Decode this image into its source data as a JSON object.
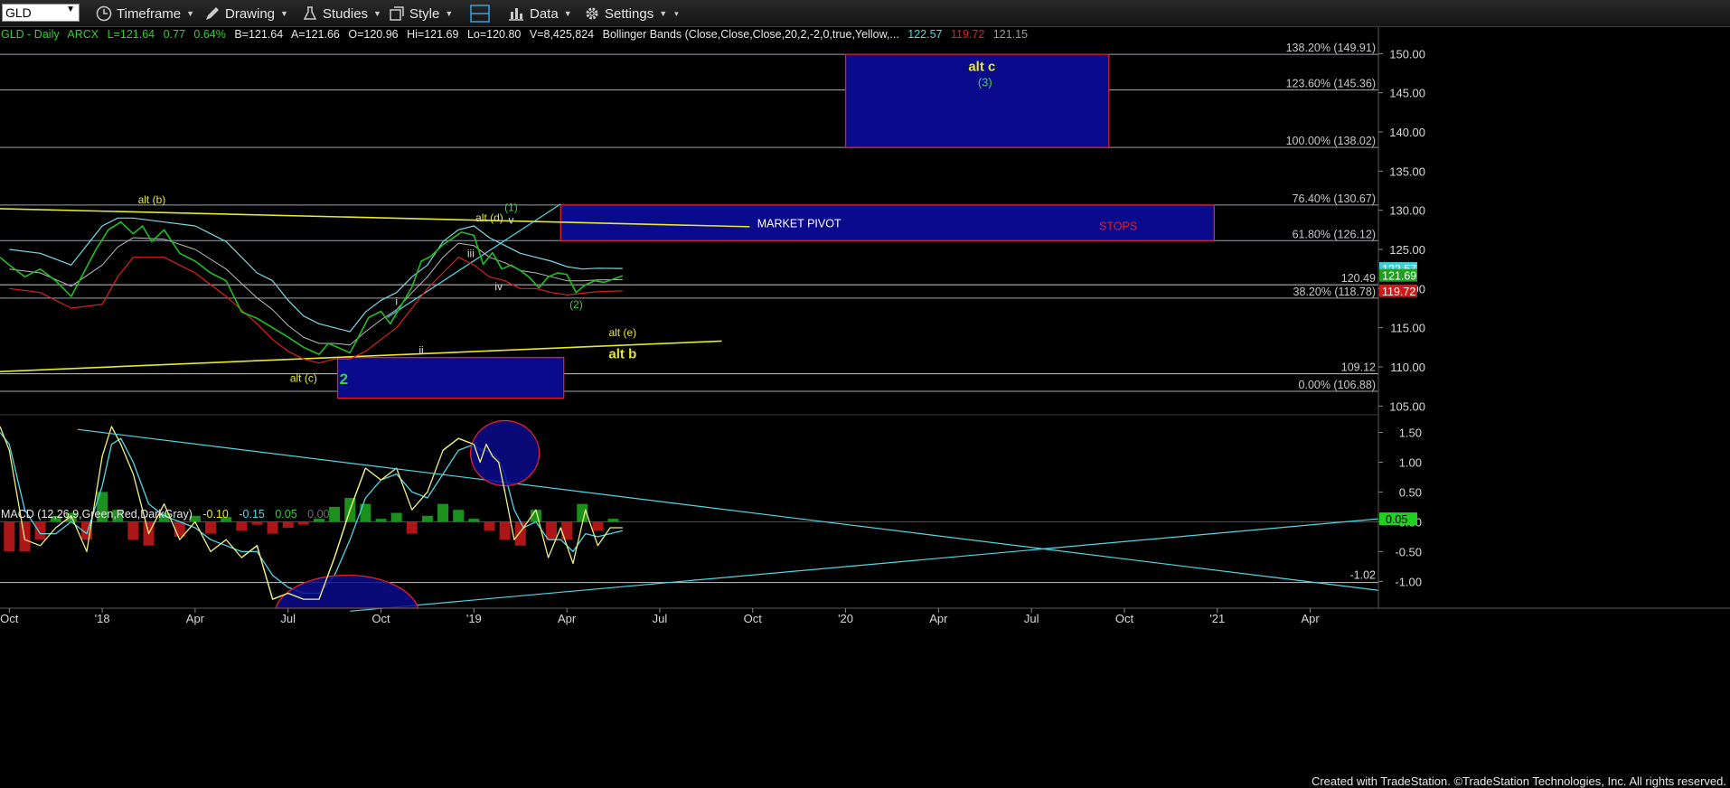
{
  "toolbar": {
    "symbol": "GLD",
    "timeframe": "Timeframe",
    "drawing": "Drawing",
    "studies": "Studies",
    "style": "Style",
    "data": "Data",
    "settings": "Settings"
  },
  "header": {
    "name": "GLD - Daily",
    "exchange": "ARCX",
    "last": "L=121.64",
    "change": "0.77",
    "change_pct": "0.64%",
    "bid": "B=121.64",
    "ask": "A=121.66",
    "open": "O=120.96",
    "high": "Hi=121.69",
    "low": "Lo=120.80",
    "volume": "V=8,425,824",
    "bb_label": "Bollinger Bands (Close,Close,Close,20,2,-2,0,true,Yellow,...",
    "bb_upper": "122.57",
    "bb_lower": "119.72",
    "bb_mid": "121.15"
  },
  "macd_header": {
    "label": "MACD (12,26,9,Green,Red,DarkGray)",
    "macd": "-0.10",
    "signal": "-0.15",
    "diff": "0.05",
    "zero": "0.00"
  },
  "colors": {
    "price": "#20c020",
    "upper_band": "#7fd8e8",
    "lower_band": "#e02020",
    "mid_band": "#bbbbbb",
    "trendline": "#e8e830",
    "box_fill": "#0a0a8c",
    "box_border": "#e0202a",
    "fib_line": "#9aa3ad",
    "wave_label": "#e8e830",
    "wave_label_green": "#40d040",
    "macd_line": "#f0f080",
    "signal_line": "#4fd8e8",
    "hist_pos": "#1fa01f",
    "hist_neg": "#c01818"
  },
  "fib_labels": [
    {
      "text": "138.20% (149.91)",
      "value": 149.91
    },
    {
      "text": "123.60% (145.36)",
      "value": 145.36
    },
    {
      "text": "100.00% (138.02)",
      "value": 138.02
    },
    {
      "text": "76.40% (130.67)",
      "value": 130.67
    },
    {
      "text": "61.80% (126.12)",
      "value": 126.12
    },
    {
      "text": "38.20% (118.78)",
      "value": 118.78
    },
    {
      "text": "0.00% (106.88)",
      "value": 106.88
    }
  ],
  "level_labels": [
    {
      "text": "120.49",
      "value": 120.49
    },
    {
      "text": "109.12",
      "value": 109.12
    }
  ],
  "price_tags": [
    {
      "text": "122.57",
      "value": 122.57,
      "color": "#3fd0d8"
    },
    {
      "text": "121.69",
      "value": 121.69,
      "color": "#1fa01f"
    },
    {
      "text": "119.72",
      "value": 119.72,
      "color": "#d01818"
    }
  ],
  "annotations": {
    "alt_c": "alt c",
    "wave_3": "(3)",
    "market_pivot": "MARKET PIVOT",
    "stops": "STOPS",
    "alt_b_paren": "alt (b)",
    "alt_d_paren": "alt (d)",
    "wave_1": "(1)",
    "v": "v",
    "iii": "iii",
    "iv": "iv",
    "i": "i",
    "ii": "ii",
    "wave_2_paren": "(2)",
    "alt_e_paren": "alt (e)",
    "alt_b": "alt b",
    "alt_c_paren": "alt (c)",
    "wave_2": "2"
  },
  "macd_tags": [
    {
      "text": "0.05",
      "value": 0.05
    },
    {
      "text": "-1.02",
      "value": -1.02
    }
  ],
  "chart_data": {
    "type": "line",
    "title": "GLD - Daily",
    "price_axis": {
      "ylim": [
        104,
        152
      ],
      "ticks": [
        105.0,
        110.0,
        115.0,
        120.0,
        125.0,
        130.0,
        135.0,
        140.0,
        145.0,
        150.0
      ]
    },
    "macd_axis": {
      "ylim": [
        -1.45,
        1.75
      ],
      "ticks": [
        1.5,
        1.0,
        0.5,
        0.0,
        -0.5,
        -1.0
      ]
    },
    "x_tick_labels": [
      "Oct",
      "'18",
      "Apr",
      "Jul",
      "Oct",
      "'19",
      "Apr",
      "Jul",
      "Oct",
      "'20",
      "Apr",
      "Jul",
      "Oct",
      "'21",
      "Apr"
    ],
    "x_tick_months": [
      0,
      3,
      6,
      9,
      12,
      15,
      18,
      21,
      24,
      27,
      30,
      33,
      36,
      39,
      42
    ],
    "x_range_months": [
      -0.3,
      44.2
    ],
    "x_month_zero": "Oct 2017",
    "price_series": {
      "name": "GLD",
      "x": [
        -0.3,
        0,
        0.5,
        1,
        1.5,
        2,
        2.4,
        2.8,
        3.2,
        3.6,
        4,
        4.3,
        4.6,
        5,
        5.5,
        6,
        6.5,
        7,
        7.5,
        8,
        8.5,
        9,
        9.5,
        10,
        10.3,
        10.6,
        11,
        11.3,
        11.6,
        12,
        12.3,
        12.6,
        13,
        13.3,
        13.6,
        14,
        14.3,
        14.6,
        15,
        15.3,
        15.6,
        15.9,
        16.2,
        16.5,
        16.8,
        17.1,
        17.4,
        17.7,
        18,
        18.3,
        18.6,
        18.9,
        19.2,
        19.5,
        19.8
      ],
      "y": [
        124,
        123,
        121.5,
        122.5,
        121,
        119,
        122,
        125,
        127.5,
        128.5,
        127,
        128,
        126,
        127.5,
        124.5,
        123.5,
        122,
        121,
        117,
        116.2,
        115,
        113.8,
        112.5,
        111.6,
        113,
        112.5,
        111.8,
        114,
        116.3,
        117.1,
        115.5,
        117.5,
        120.2,
        123.5,
        124.1,
        125.6,
        126.4,
        127.2,
        126.8,
        123.1,
        124.6,
        122.5,
        123,
        122.3,
        121.4,
        120.1,
        121.5,
        122,
        121.8,
        119.5,
        120.5,
        121,
        120.8,
        121.2,
        121.64
      ]
    },
    "upper_band": {
      "x": [
        0,
        1,
        2,
        3,
        3.5,
        4,
        5,
        6,
        7,
        8,
        8.5,
        9,
        9.5,
        10,
        10.5,
        11,
        11.5,
        12,
        12.5,
        13,
        13.5,
        14,
        14.5,
        15,
        15.5,
        16,
        16.5,
        17,
        17.5,
        18,
        18.5,
        19,
        19.8
      ],
      "y": [
        125,
        124.5,
        123,
        128,
        129,
        129,
        128.5,
        128,
        126,
        122,
        121,
        118.5,
        116.5,
        115.5,
        115,
        114.5,
        117,
        118.5,
        119.5,
        121.5,
        123,
        126,
        127.5,
        128,
        126.5,
        125.5,
        124.5,
        124,
        123.5,
        122.8,
        122.5,
        122.6,
        122.57
      ]
    },
    "lower_band": {
      "x": [
        0,
        1,
        2,
        3,
        3.5,
        4,
        5,
        6,
        7,
        8,
        8.5,
        9,
        9.5,
        10,
        10.5,
        11,
        11.5,
        12,
        12.5,
        13,
        13.5,
        14,
        14.5,
        15,
        15.5,
        16,
        16.5,
        17,
        17.5,
        18,
        18.5,
        19,
        19.8
      ],
      "y": [
        120,
        119.5,
        117.5,
        118,
        121.5,
        124,
        124,
        122,
        119,
        115.5,
        113.5,
        112,
        111,
        110.5,
        111,
        111,
        112,
        113.5,
        115,
        117.5,
        120,
        122,
        124,
        123,
        121.5,
        121,
        120,
        120,
        119.5,
        119.2,
        119.4,
        119.6,
        119.72
      ]
    },
    "mid_band": {
      "x": [
        0,
        1,
        2,
        3,
        3.5,
        4,
        5,
        6,
        7,
        8,
        8.5,
        9,
        9.5,
        10,
        10.5,
        11,
        11.5,
        12,
        12.5,
        13,
        13.5,
        14,
        14.5,
        15,
        15.5,
        16,
        16.5,
        17,
        17.5,
        18,
        18.5,
        19,
        19.8
      ],
      "y": [
        122.5,
        122,
        120.3,
        123,
        125.3,
        126.5,
        126.3,
        125,
        122.5,
        118.8,
        117.3,
        115.3,
        113.8,
        113,
        113,
        112.8,
        114.5,
        116,
        117.3,
        119.5,
        121.5,
        124,
        125.8,
        125.5,
        124,
        123.3,
        122.3,
        122,
        121.5,
        121,
        121,
        121.1,
        121.15
      ]
    },
    "fib_levels": [
      149.91,
      145.36,
      138.02,
      130.67,
      126.12,
      118.78,
      106.88
    ],
    "levels": [
      120.49,
      109.12
    ],
    "macd_series": {
      "name": "MACD",
      "x": [
        -0.3,
        0,
        0.5,
        1,
        1.5,
        2,
        2.5,
        3,
        3.3,
        3.6,
        4,
        4.5,
        5,
        5.5,
        6,
        6.5,
        7,
        7.5,
        8,
        8.5,
        9,
        9.5,
        10,
        10.5,
        11,
        11.5,
        12,
        12.5,
        13,
        13.5,
        14,
        14.5,
        15,
        15.2,
        15.4,
        15.6,
        15.8,
        16,
        16.3,
        16.6,
        17,
        17.4,
        17.8,
        18.2,
        18.6,
        19,
        19.4,
        19.8
      ],
      "y": [
        1.6,
        1.2,
        -0.3,
        -0.4,
        -0.1,
        0.1,
        -0.5,
        1.1,
        1.6,
        1.3,
        0.8,
        -0.2,
        0.3,
        -0.3,
        0.0,
        -0.5,
        -0.3,
        -0.6,
        -0.4,
        -1.3,
        -1.2,
        -1.3,
        -1.3,
        -0.6,
        0.2,
        0.9,
        0.7,
        0.9,
        0.2,
        0.5,
        1.2,
        1.4,
        1.3,
        1.0,
        1.3,
        1.1,
        1.0,
        0.5,
        -0.3,
        -0.1,
        0.2,
        -0.6,
        -0.1,
        -0.7,
        0.2,
        -0.4,
        -0.1,
        -0.1
      ]
    },
    "signal_series": {
      "name": "Signal",
      "x": [
        -0.3,
        0,
        0.5,
        1,
        1.5,
        2,
        2.5,
        3,
        3.3,
        3.6,
        4,
        4.5,
        5,
        5.5,
        6,
        6.5,
        7,
        7.5,
        8,
        8.5,
        9,
        9.5,
        10,
        10.5,
        11,
        11.5,
        12,
        12.5,
        13,
        13.5,
        14,
        14.5,
        15,
        15.2,
        15.4,
        15.6,
        15.8,
        16,
        16.3,
        16.6,
        17,
        17.4,
        17.8,
        18.2,
        18.6,
        19,
        19.4,
        19.8
      ],
      "y": [
        1.5,
        1.3,
        0.2,
        -0.2,
        -0.2,
        0.0,
        -0.2,
        0.6,
        1.3,
        1.4,
        1.0,
        0.3,
        0.1,
        0.0,
        -0.1,
        -0.3,
        -0.4,
        -0.5,
        -0.5,
        -0.9,
        -1.1,
        -1.2,
        -1.2,
        -0.9,
        -0.3,
        0.4,
        0.7,
        0.8,
        0.5,
        0.4,
        0.8,
        1.2,
        1.3,
        1.2,
        1.2,
        1.15,
        1.05,
        0.8,
        0.2,
        -0.1,
        0.0,
        -0.3,
        -0.3,
        -0.5,
        -0.2,
        -0.25,
        -0.2,
        -0.15
      ]
    },
    "histogram": {
      "x": [
        0,
        0.5,
        1,
        1.5,
        2,
        2.5,
        3,
        3.5,
        4,
        4.5,
        5,
        5.5,
        6,
        6.5,
        7,
        7.5,
        8,
        8.5,
        9,
        9.5,
        10,
        10.5,
        11,
        11.5,
        12,
        12.5,
        13,
        13.5,
        14,
        14.5,
        15,
        15.5,
        16,
        16.5,
        17,
        17.5,
        18,
        18.5,
        19,
        19.5
      ],
      "y": [
        -0.5,
        -0.5,
        -0.3,
        0.1,
        0.15,
        -0.3,
        0.5,
        0.2,
        -0.3,
        -0.4,
        0.15,
        -0.25,
        0.1,
        -0.2,
        0.08,
        -0.15,
        -0.05,
        -0.2,
        -0.1,
        -0.05,
        0.05,
        0.25,
        0.4,
        0.3,
        0.05,
        0.15,
        -0.2,
        0.1,
        0.3,
        0.2,
        0.05,
        -0.15,
        -0.3,
        -0.4,
        0.2,
        -0.3,
        -0.3,
        0.3,
        -0.15,
        0.05
      ]
    }
  },
  "footer": "Created with TradeStation. ©TradeStation Technologies, Inc. All rights reserved."
}
